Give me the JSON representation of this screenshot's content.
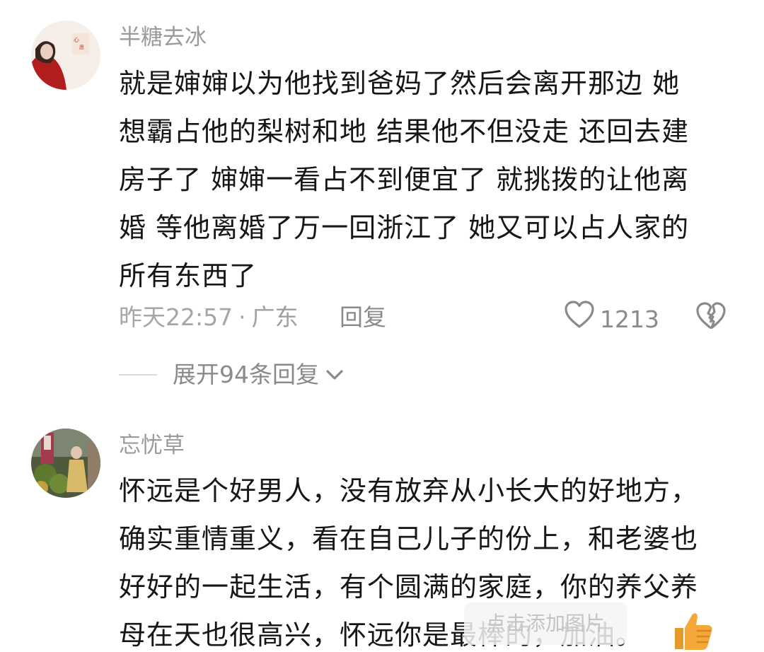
{
  "comments": [
    {
      "username": "半糖去冰",
      "lines": [
        "就是婶婶以为他找到爸妈了然后会离开那边 她",
        "想霸占他的梨树和地 结果他不但没走 还回去建",
        "房子了 婶婶一看占不到便宜了 就挑拨的让他离",
        "婚 等他离婚了万一回浙江了 她又可以占人家的",
        "所有东西了"
      ],
      "time": "昨天22:57",
      "dot": "·",
      "location": "广东",
      "reply_label": "回复",
      "like_count": "1213",
      "expand_label": "展开94条回复"
    },
    {
      "username": "忘忧草",
      "lines": [
        "怀远是个好男人，没有放弃从小长大的好地方，",
        "确实重情重义，看在自己儿子的份上，和老婆也",
        "好好的一起生活，有个圆满的家庭，你的养父养",
        "母在天也很高兴，怀远你是最棒的，加油。"
      ]
    }
  ],
  "overlay": {
    "add_image_hint": "点击添加图片"
  },
  "colors": {
    "text": "#161616",
    "muted": "#9a9a9a",
    "thumb": "#f4a83a"
  }
}
